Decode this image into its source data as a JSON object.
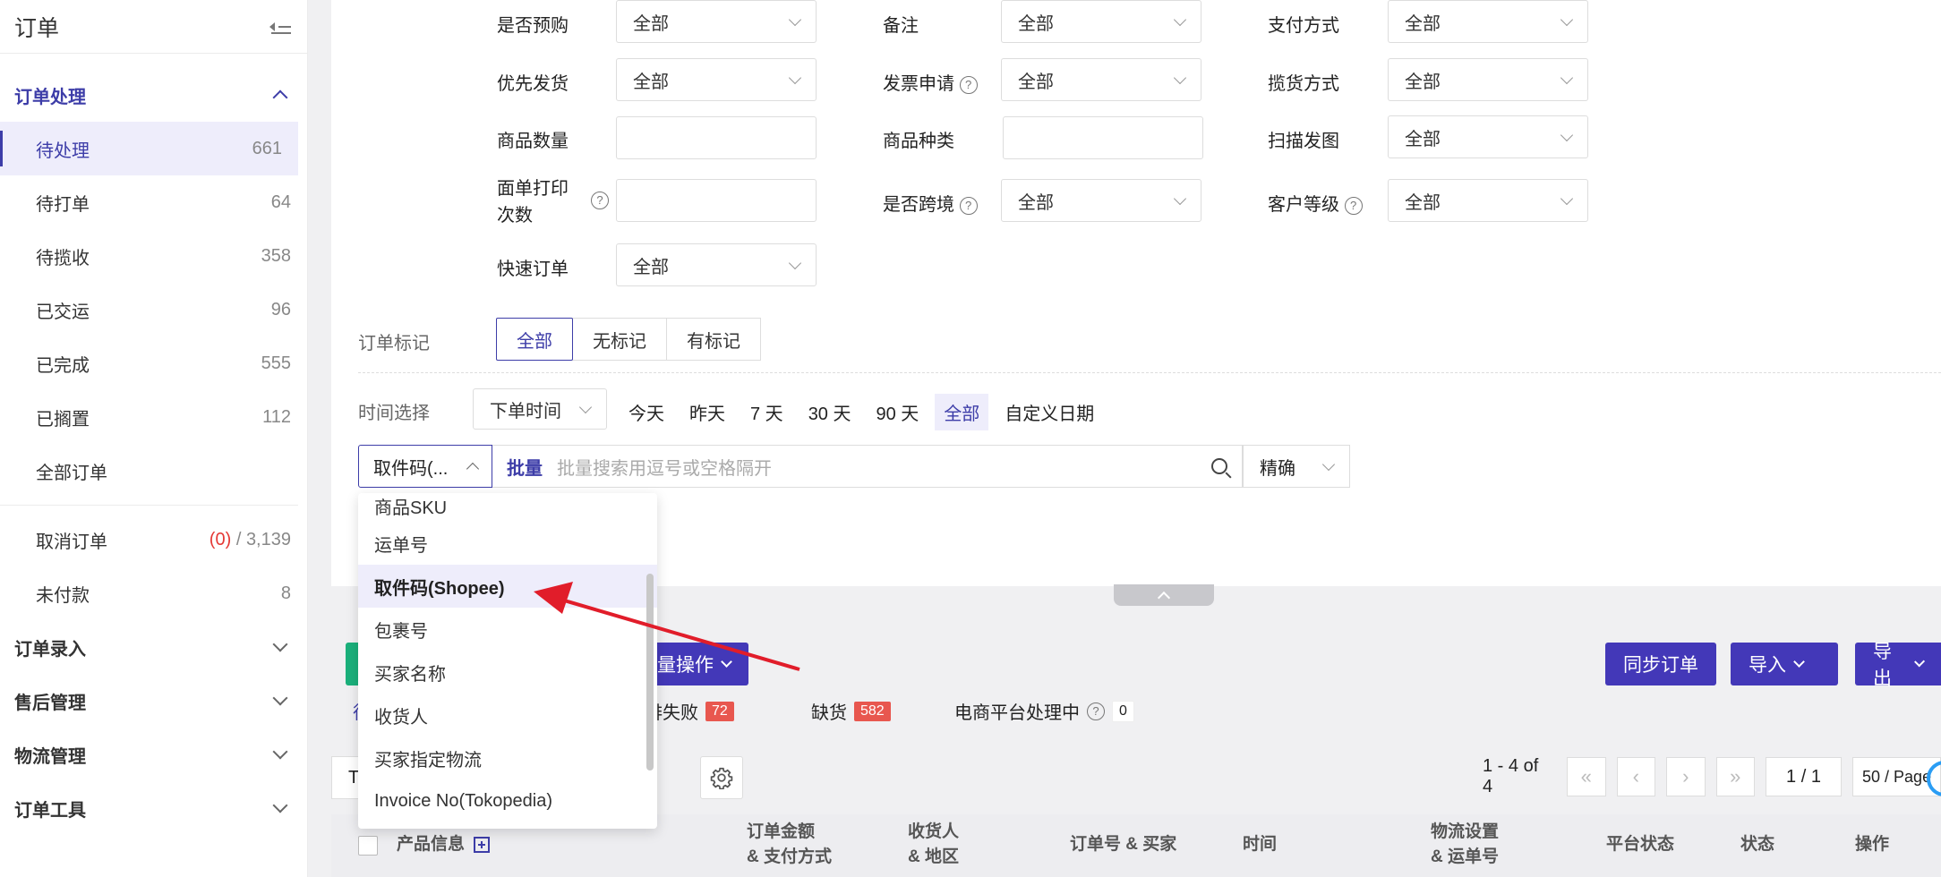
{
  "sidebar": {
    "title": "订单",
    "groups": {
      "order_processing": "订单处理",
      "order_entry": "订单录入",
      "after_sales": "售后管理",
      "logistics": "物流管理",
      "order_tools": "订单工具"
    },
    "items": [
      {
        "label": "待处理",
        "count": "661"
      },
      {
        "label": "待打单",
        "count": "64"
      },
      {
        "label": "待揽收",
        "count": "358"
      },
      {
        "label": "已交运",
        "count": "96"
      },
      {
        "label": "已完成",
        "count": "555"
      },
      {
        "label": "已搁置",
        "count": "112"
      },
      {
        "label": "全部订单",
        "count": ""
      }
    ],
    "cancel": {
      "label": "取消订单",
      "count_red": "(0)",
      "sep": "/",
      "total": "3,139"
    },
    "unpaid": {
      "label": "未付款",
      "count": "8"
    }
  },
  "filters": {
    "presale": {
      "label": "是否预购",
      "value": "全部"
    },
    "remark": {
      "label": "备注",
      "value": "全部"
    },
    "payment": {
      "label": "支付方式",
      "value": "全部"
    },
    "priority": {
      "label": "优先发货",
      "value": "全部"
    },
    "invoice": {
      "label": "发票申请",
      "value": "全部"
    },
    "pickup": {
      "label": "揽货方式",
      "value": "全部"
    },
    "qty": {
      "label": "商品数量"
    },
    "kinds": {
      "label": "商品种类"
    },
    "scan": {
      "label": "扫描发图",
      "value": "全部"
    },
    "print_times": {
      "label_1": "面单打印",
      "label_2": "次数"
    },
    "cross_border": {
      "label": "是否跨境",
      "value": "全部"
    },
    "customer_level": {
      "label": "客户等级",
      "value": "全部"
    },
    "quick": {
      "label": "快速订单",
      "value": "全部"
    },
    "mark": {
      "label": "订单标记",
      "options": [
        "全部",
        "无标记",
        "有标记"
      ]
    },
    "time": {
      "label": "时间选择",
      "type": "下单时间",
      "options": [
        "今天",
        "昨天",
        "7 天",
        "30 天",
        "90 天",
        "全部",
        "自定义日期"
      ]
    }
  },
  "search": {
    "type": "取件码(...",
    "batch": "批量",
    "placeholder": "批量搜索用逗号或空格隔开",
    "exact": "精确"
  },
  "dropdown": {
    "items": [
      "商品SKU",
      "运单号",
      "取件码(Shopee)",
      "包裹号",
      "买家名称",
      "收货人",
      "买家指定物流",
      "Invoice No(Tokopedia)"
    ]
  },
  "actions": {
    "bulk": "量操作",
    "sync": "同步订单",
    "import": "导入",
    "export": "导出"
  },
  "status": {
    "fail": {
      "label": "排失败",
      "count": "72"
    },
    "stockout": {
      "label": "缺货",
      "count": "582"
    },
    "platform": {
      "label": "电商平台处理中",
      "count": "0"
    },
    "tab_stub": "待"
  },
  "pager": {
    "range": "1 - 4 of 4",
    "page": "1 / 1",
    "size": "50 / Page"
  },
  "left_input_stub": "T",
  "table": {
    "product": "产品信息",
    "amount_1": "订单金额",
    "amount_2": "& 支付方式",
    "recv_1": "收货人",
    "recv_2": "& 地区",
    "order_no": "订单号 & 买家",
    "time": "时间",
    "logi_1": "物流设置",
    "logi_2": "& 运单号",
    "platform_status": "平台状态",
    "status": "状态",
    "op": "操作"
  },
  "colors": {
    "accent": "#3d3da8",
    "primary_btn": "#4338b8",
    "badge_red": "#e8574f",
    "arrow": "#e11d2a"
  }
}
